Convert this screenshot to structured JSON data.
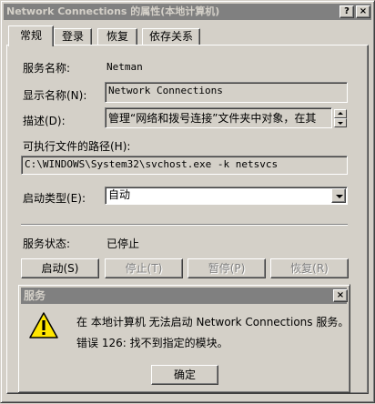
{
  "window": {
    "title": "Network Connections 的属性(本地计算机)",
    "help_button": "?",
    "close_button": "×"
  },
  "tabs": [
    {
      "label": "常规",
      "active": true
    },
    {
      "label": "登录",
      "active": false
    },
    {
      "label": "恢复",
      "active": false
    },
    {
      "label": "依存关系",
      "active": false
    }
  ],
  "general": {
    "service_name_label": "服务名称:",
    "service_name_value": "Netman",
    "display_name_label": "显示名称(N):",
    "display_name_value": "Network Connections",
    "description_label": "描述(D):",
    "description_value": "管理“网络和拨号连接”文件夹中对象，在其",
    "exe_path_label": "可执行文件的路径(H):",
    "exe_path_value": "C:\\WINDOWS\\System32\\svchost.exe -k netsvcs",
    "startup_type_label": "启动类型(E):",
    "startup_type_value": "自动",
    "service_status_label": "服务状态:",
    "service_status_value": "已停止",
    "buttons": {
      "start": "启动(S)",
      "stop": "停止(T)",
      "pause": "暂停(P)",
      "resume": "恢复(R)"
    }
  },
  "message_box": {
    "title": "服务",
    "close_button": "×",
    "line1": "在 本地计算机 无法启动 Network Connections 服务。",
    "line2": "错误 126: 找不到指定的模块。",
    "icon": "warning-icon",
    "ok_button": "确定"
  }
}
